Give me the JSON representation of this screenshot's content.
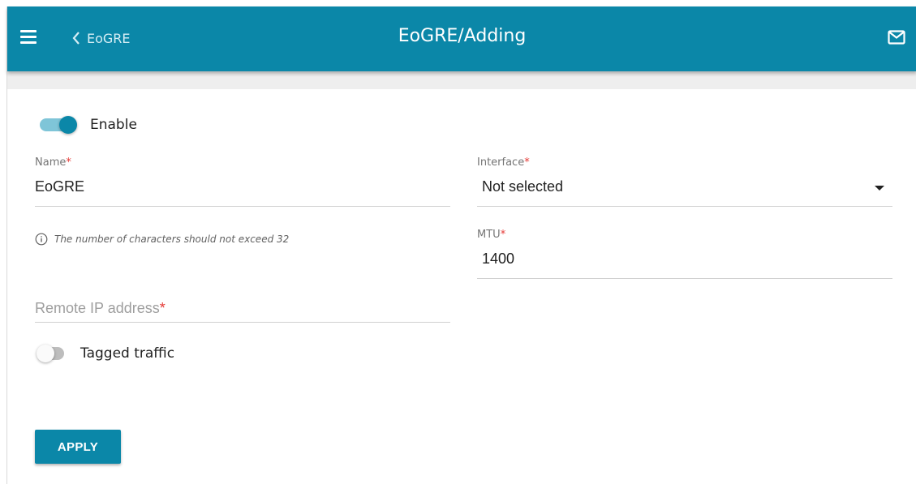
{
  "header": {
    "back_label": "EoGRE",
    "title": "EoGRE/Adding",
    "icons": [
      "menu-icon",
      "chevron-left-icon",
      "mail-icon"
    ],
    "color": "#0b87a8"
  },
  "form": {
    "enable": {
      "label": "Enable",
      "checked": true
    },
    "name": {
      "label": "Name",
      "required_mark": "*",
      "value": "EoGRE",
      "hint": "The number of characters should not exceed 32",
      "hint_icon": "info-icon"
    },
    "interface": {
      "label": "Interface",
      "required_mark": "*",
      "value": "Not selected"
    },
    "mtu": {
      "label": "MTU",
      "required_mark": "*",
      "value": "1400"
    },
    "remote_ip": {
      "placeholder": "Remote IP address",
      "required_mark": "*",
      "value": ""
    },
    "tagged_traffic": {
      "label": "Tagged traffic",
      "checked": false
    },
    "apply_label": "APPLY"
  }
}
